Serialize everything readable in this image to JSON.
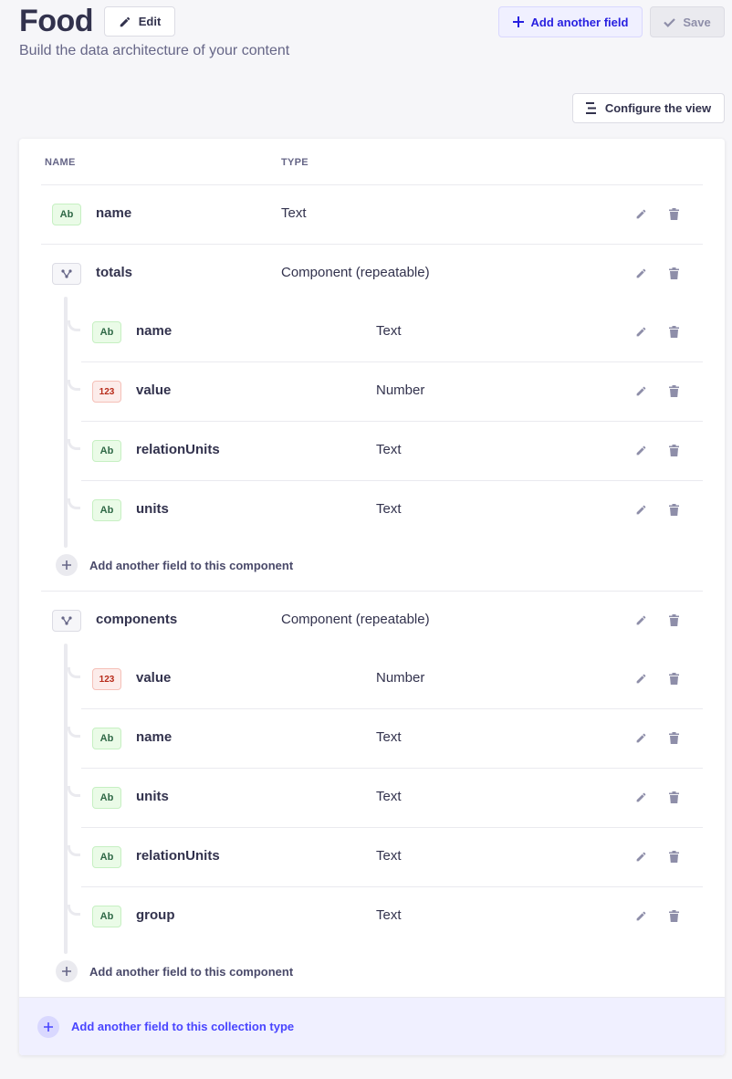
{
  "header": {
    "title": "Food",
    "subtitle": "Build the data architecture of your content",
    "edit_label": "Edit",
    "add_field_label": "Add another field",
    "save_label": "Save",
    "configure_label": "Configure the view"
  },
  "table": {
    "col_name": "NAME",
    "col_type": "TYPE"
  },
  "badges": {
    "text": "Ab",
    "number": "123"
  },
  "fields": [
    {
      "name": "name",
      "type": "Text",
      "icon": "text"
    },
    {
      "name": "totals",
      "type": "Component (repeatable)",
      "icon": "component",
      "children": [
        {
          "name": "name",
          "type": "Text",
          "icon": "text"
        },
        {
          "name": "value",
          "type": "Number",
          "icon": "number"
        },
        {
          "name": "relationUnits",
          "type": "Text",
          "icon": "text"
        },
        {
          "name": "units",
          "type": "Text",
          "icon": "text"
        }
      ],
      "add_label": "Add another field to this component"
    },
    {
      "name": "components",
      "type": "Component (repeatable)",
      "icon": "component",
      "children": [
        {
          "name": "value",
          "type": "Number",
          "icon": "number"
        },
        {
          "name": "name",
          "type": "Text",
          "icon": "text"
        },
        {
          "name": "units",
          "type": "Text",
          "icon": "text"
        },
        {
          "name": "relationUnits",
          "type": "Text",
          "icon": "text"
        },
        {
          "name": "group",
          "type": "Text",
          "icon": "text"
        }
      ],
      "add_label": "Add another field to this component"
    }
  ],
  "footer": {
    "add_label": "Add another field to this collection type"
  },
  "colors": {
    "primary": "#4945ff",
    "text_badge_bg": "#eafbe7",
    "number_badge_bg": "#fcecea"
  }
}
